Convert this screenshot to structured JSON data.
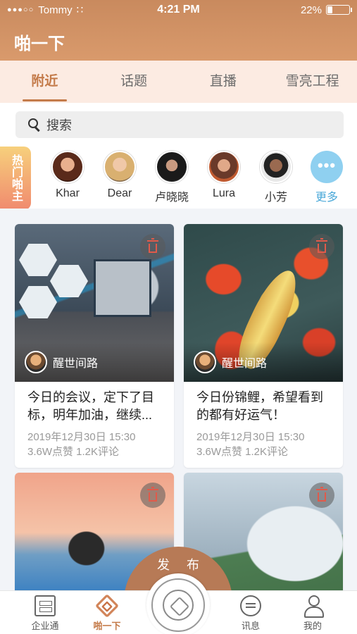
{
  "status_bar": {
    "carrier": "Tommy",
    "time": "4:21 PM",
    "battery": "22%"
  },
  "header": {
    "title": "啪一下"
  },
  "tabs": [
    {
      "label": "附近",
      "active": true
    },
    {
      "label": "话题",
      "active": false
    },
    {
      "label": "直播",
      "active": false
    },
    {
      "label": "雪亮工程",
      "active": false
    }
  ],
  "search": {
    "placeholder": "搜索"
  },
  "hot_hosts": {
    "badge": "热门啪主",
    "hosts": [
      {
        "name": "Khar"
      },
      {
        "name": "Dear"
      },
      {
        "name": "卢晓晓"
      },
      {
        "name": "Lura"
      },
      {
        "name": "小芳"
      }
    ],
    "more_label": "更多",
    "more_glyph": "•••"
  },
  "posts": [
    {
      "author": "醒世间路",
      "text": "今日的会议，定下了目标，明年加油，继续...",
      "date": "2019年12月30日  15:30",
      "stats": "3.6W点赞  1.2K评论"
    },
    {
      "author": "醒世间路",
      "text": "今日份锦鲤，希望看到的都有好运气！",
      "date": "2019年12月30日  15:30",
      "stats": "3.6W点赞  1.2K评论"
    },
    {
      "author": "",
      "text": "",
      "date": "",
      "stats": ""
    },
    {
      "author": "",
      "text": "",
      "date": "",
      "stats": ""
    }
  ],
  "publish_label": "发布",
  "tabbar": [
    {
      "label": "企业通",
      "icon": "building-icon"
    },
    {
      "label": "啪一下",
      "icon": "papa-icon",
      "active": true
    },
    {
      "label": "讯息",
      "icon": "message-icon"
    },
    {
      "label": "我的",
      "icon": "profile-icon"
    }
  ],
  "colors": {
    "accent": "#c47b4a",
    "header": "#d1926a",
    "more": "#8fd0f0"
  }
}
